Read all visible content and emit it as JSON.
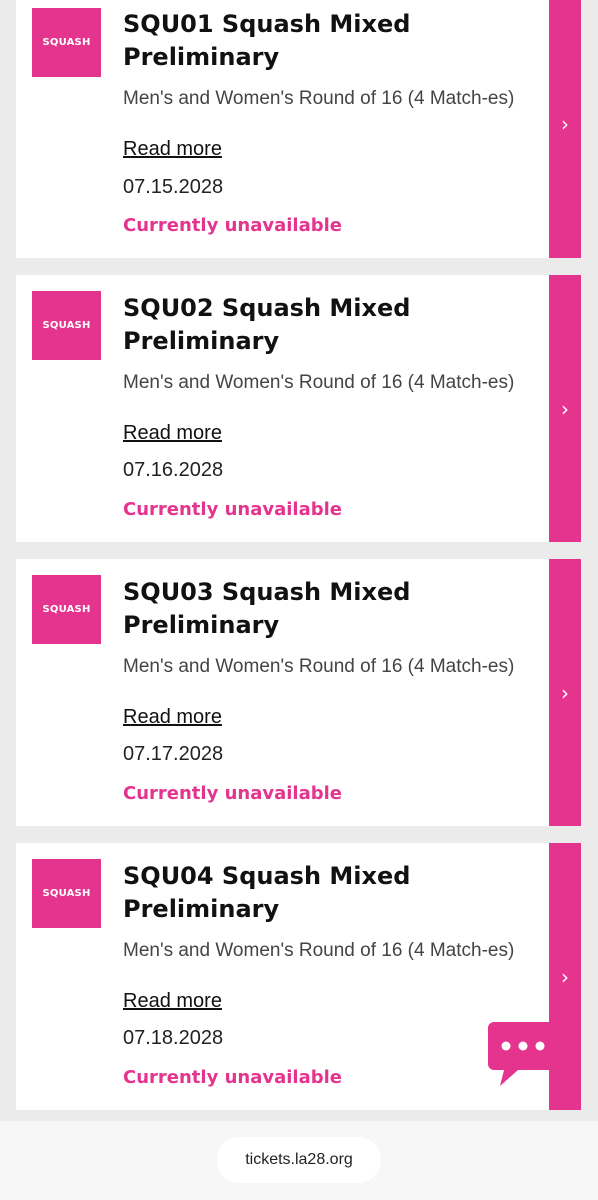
{
  "events": [
    {
      "logo_text": "SQUASH",
      "title": "SQU01 Squash Mixed Preliminary",
      "description": "Men's and Women's Round of 16 (4 Match-es)",
      "read_more": "Read more",
      "date": "07.15.2028",
      "status": "Currently unavailable",
      "chevron": "›"
    },
    {
      "logo_text": "SQUASH",
      "title": "SQU02 Squash Mixed Preliminary",
      "description": "Men's and Women's Round of 16 (4 Match-es)",
      "read_more": "Read more",
      "date": "07.16.2028",
      "status": "Currently unavailable",
      "chevron": "›"
    },
    {
      "logo_text": "SQUASH",
      "title": "SQU03 Squash Mixed Preliminary",
      "description": "Men's and Women's Round of 16 (4 Match-es)",
      "read_more": "Read more",
      "date": "07.17.2028",
      "status": "Currently unavailable",
      "chevron": "›"
    },
    {
      "logo_text": "SQUASH",
      "title": "SQU04 Squash Mixed Preliminary",
      "description": "Men's and Women's Round of 16 (4 Match-es)",
      "read_more": "Read more",
      "date": "07.18.2028",
      "status": "Currently unavailable",
      "chevron": "›"
    }
  ],
  "chat": {
    "icon": "chat-bubble-icon"
  },
  "browser": {
    "url": "tickets.la28.org"
  },
  "colors": {
    "accent": "#e4348e",
    "background": "#ebebeb",
    "card": "#ffffff"
  }
}
